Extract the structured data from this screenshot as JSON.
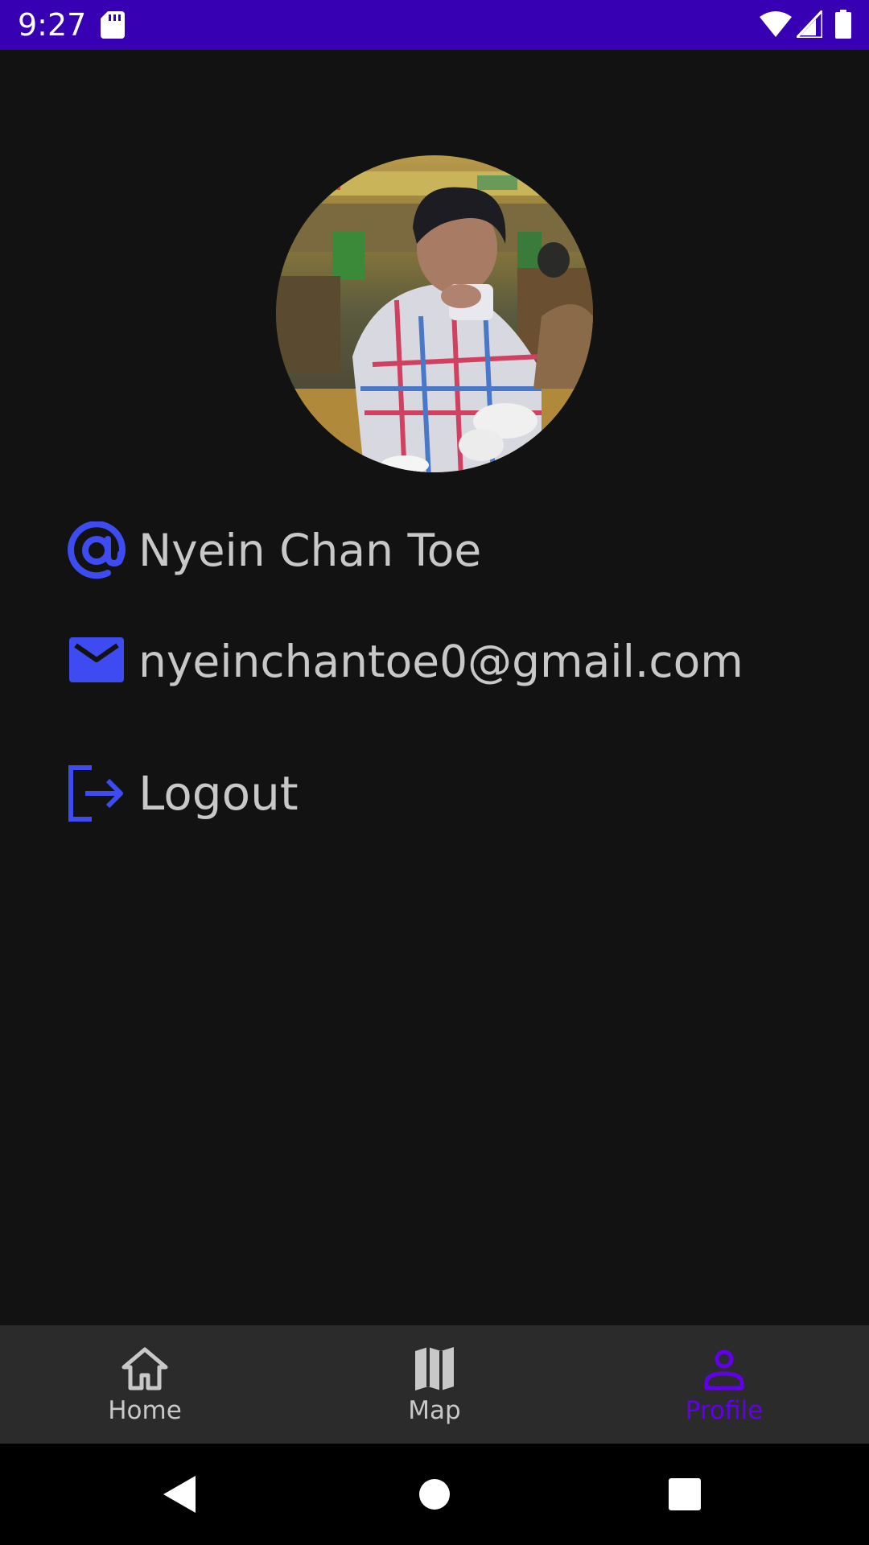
{
  "status_bar": {
    "time": "9:27",
    "icons": [
      "sd-card-icon",
      "wifi-icon",
      "signal-icon",
      "battery-icon"
    ],
    "background": "#3700b3"
  },
  "profile": {
    "avatar": "profile-photo",
    "name": "Nyein Chan Toe",
    "email": "nyeinchantoe0@gmail.com",
    "logout_label": "Logout",
    "icons": {
      "name": "at-sign-icon",
      "email": "mail-icon",
      "logout": "logout-icon"
    },
    "accent": "#3d4bf0"
  },
  "bottom_nav": {
    "items": [
      {
        "label": "Home",
        "icon": "home-icon",
        "selected": false
      },
      {
        "label": "Map",
        "icon": "map-icon",
        "selected": false
      },
      {
        "label": "Profile",
        "icon": "person-icon",
        "selected": true
      }
    ],
    "selected_color": "#6200ee",
    "unselected_color": "#c8c8c8"
  },
  "system_nav": {
    "icons": [
      "back-icon",
      "home-circle-icon",
      "recents-icon"
    ]
  }
}
